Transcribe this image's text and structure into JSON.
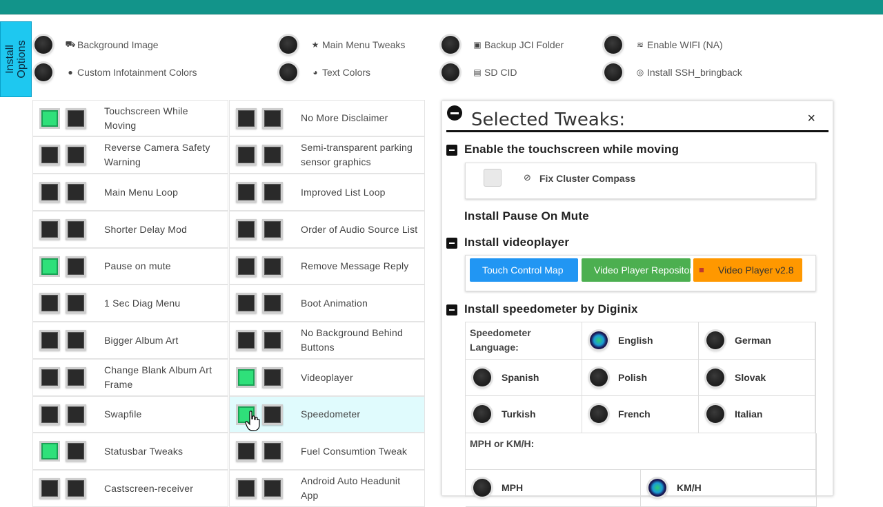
{
  "side_tab": {
    "label": "Install\nOptions"
  },
  "options_row1": [
    {
      "icon": "car-icon",
      "glyph": "⛟",
      "label": "Background Image"
    },
    {
      "icon": "star-icon",
      "glyph": "★",
      "label": "Main Menu Tweaks"
    },
    {
      "icon": "save-icon",
      "glyph": "▣",
      "label": "Backup JCI Folder"
    },
    {
      "icon": "wifi-icon",
      "glyph": "≋",
      "label": "Enable WIFI (NA)"
    }
  ],
  "options_row2": [
    {
      "icon": "tint-icon",
      "glyph": "●",
      "label": "Custom Infotainment Colors"
    },
    {
      "icon": "palette-icon",
      "glyph": "◕",
      "label": "Text Colors"
    },
    {
      "icon": "sd-card-icon",
      "glyph": "▤",
      "label": "SD CID"
    },
    {
      "icon": "fingerprint-icon",
      "glyph": "◎",
      "label": "Install SSH_bringback"
    }
  ],
  "tweaks": [
    {
      "left": {
        "label": "Touchscreen While Moving",
        "on": true
      },
      "right": {
        "label": "No More Disclaimer",
        "on": false
      }
    },
    {
      "left": {
        "label": "Reverse Camera Safety Warning",
        "on": false
      },
      "right": {
        "label": "Semi-transparent parking sensor graphics",
        "on": false
      }
    },
    {
      "left": {
        "label": "Main Menu Loop",
        "on": false
      },
      "right": {
        "label": "Improved List Loop",
        "on": false
      }
    },
    {
      "left": {
        "label": "Shorter Delay Mod",
        "on": false
      },
      "right": {
        "label": "Order of Audio Source List",
        "on": false
      }
    },
    {
      "left": {
        "label": "Pause on mute",
        "on": true
      },
      "right": {
        "label": "Remove Message Reply",
        "on": false
      }
    },
    {
      "left": {
        "label": "1 Sec Diag Menu",
        "on": false
      },
      "right": {
        "label": "Boot Animation",
        "on": false
      }
    },
    {
      "left": {
        "label": "Bigger Album Art",
        "on": false
      },
      "right": {
        "label": "No Background Behind Buttons",
        "on": false
      }
    },
    {
      "left": {
        "label": "Change Blank Album Art Frame",
        "on": false
      },
      "right": {
        "label": "Videoplayer",
        "on": true
      }
    },
    {
      "left": {
        "label": "Swapfile",
        "on": false
      },
      "right": {
        "label": "Speedometer",
        "on": true,
        "highlighted": true
      }
    },
    {
      "left": {
        "label": "Statusbar Tweaks",
        "on": true
      },
      "right": {
        "label": "Fuel Consumtion Tweak",
        "on": false
      }
    },
    {
      "left": {
        "label": "Castscreen-receiver",
        "on": false
      },
      "right": {
        "label": "Android Auto Headunit App",
        "on": false
      }
    }
  ],
  "panel": {
    "title": "Selected Tweaks:",
    "close": "×",
    "sec_touch": "Enable the touchscreen while moving",
    "fix_compass": "Fix Cluster Compass",
    "sec_pause": "Install Pause On Mute",
    "sec_video": "Install videoplayer",
    "btn_touch": "Touch Control Map",
    "btn_repo": "Video Player Repository",
    "btn_ver": "Video Player v2.8",
    "sec_speedo": "Install speedometer by Diginix",
    "lang_label": "Speedometer Language:",
    "languages": [
      {
        "label": "English",
        "on": true
      },
      {
        "label": "German",
        "on": false
      },
      {
        "label": "Spanish",
        "on": false
      },
      {
        "label": "Polish",
        "on": false
      },
      {
        "label": "Slovak",
        "on": false
      },
      {
        "label": "Turkish",
        "on": false
      },
      {
        "label": "French",
        "on": false
      },
      {
        "label": "Italian",
        "on": false
      }
    ],
    "unit_label": "MPH or KM/H:",
    "units": [
      {
        "label": "MPH",
        "on": false
      },
      {
        "label": "KM/H",
        "on": true
      }
    ]
  },
  "colors": {
    "topbar": "#12948a",
    "side_tab": "#1ec8f0",
    "toggle_on": "#2fe07a",
    "btn_blue": "#2196f3",
    "btn_green": "#4caf50",
    "btn_orange": "#ff9800"
  }
}
